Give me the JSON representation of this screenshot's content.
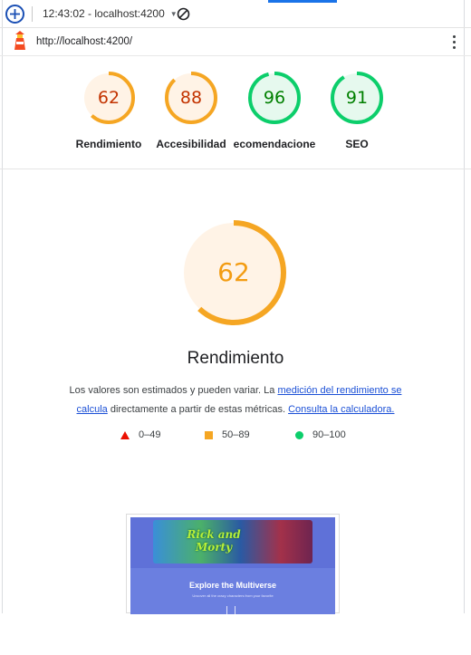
{
  "toolbar": {
    "report_label": "12:43:02 - localhost:4200",
    "url": "http://localhost:4200/"
  },
  "icons": {
    "new_report": "plus-circle-icon",
    "dropdown": "caret-down-icon",
    "clear": "block-icon",
    "logo": "lighthouse-icon",
    "menu": "kebab-menu-icon"
  },
  "summary": [
    {
      "score": "62",
      "label": "Rendimiento",
      "fraction": 0.62,
      "status": "average"
    },
    {
      "score": "88",
      "label": "Accesibilidad",
      "fraction": 0.88,
      "status": "average"
    },
    {
      "score": "96",
      "label": "ecomendacione",
      "fraction": 0.96,
      "status": "pass"
    },
    {
      "score": "91",
      "label": "SEO",
      "fraction": 0.91,
      "status": "pass"
    }
  ],
  "colors": {
    "fail": "#eb0f00",
    "average": "#f5a623",
    "average_text": "#c33300",
    "average_bg": "#fff3e6",
    "pass": "#0cce6b",
    "pass_text": "#008000",
    "pass_bg": "#e6f9ee"
  },
  "performance": {
    "score": "62",
    "fraction": 0.62,
    "title": "Rendimiento",
    "desc_prefix": "Los valores son estimados y pueden variar. La ",
    "desc_link1": "medición del rendimiento se calcula",
    "desc_middle": " directamente a partir de estas métricas. ",
    "desc_link2": "Consulta la calculadora."
  },
  "legend": [
    {
      "range": "0–49",
      "shape": "triangle"
    },
    {
      "range": "50–89",
      "shape": "square"
    },
    {
      "range": "90–100",
      "shape": "circle"
    }
  ],
  "screenshot": {
    "logo_text": "Rick and Morty",
    "title": "Explore the Multiverse",
    "subtitle": "Uncover all the crazy characters from your favorite"
  }
}
